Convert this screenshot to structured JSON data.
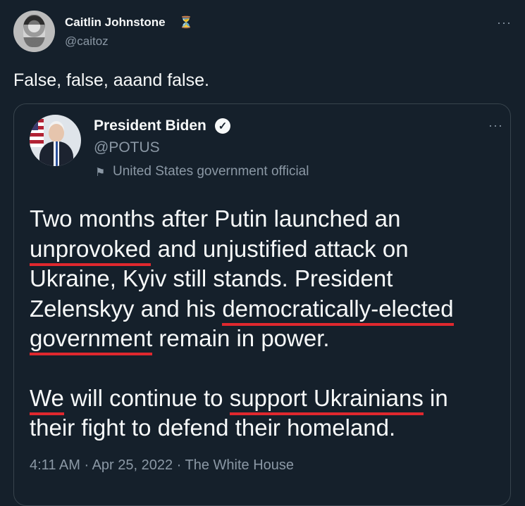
{
  "outer_tweet": {
    "name": "Caitlin Johnstone",
    "name_icon": "hourglass-icon",
    "handle": "@caitoz",
    "more": "···",
    "text": "False, false, aaand false."
  },
  "quoted_tweet": {
    "name": "President Biden",
    "verified_icon": "verified-check-icon",
    "handle": "@POTUS",
    "more": "···",
    "gov_label": "United States government official",
    "para1": {
      "t1": "Two months after Putin launched an ",
      "u1": "unprovoked",
      "t2": " and unjustified attack on Ukraine, Kyiv still stands. President Zelenskyy and his ",
      "u2": "democratically-elected government",
      "t3": " remain in power."
    },
    "para2": {
      "u1": "We",
      "t1": " will continue to ",
      "u2": "support Ukrainians",
      "t2": " in their fight to defend their homeland."
    },
    "timestamp": "4:11 AM · Apr 25, 2022 · The White House"
  },
  "colors": {
    "background": "#15202b",
    "text": "#f7f9f9",
    "secondary": "#8b98a5",
    "underline": "#e0282e"
  }
}
